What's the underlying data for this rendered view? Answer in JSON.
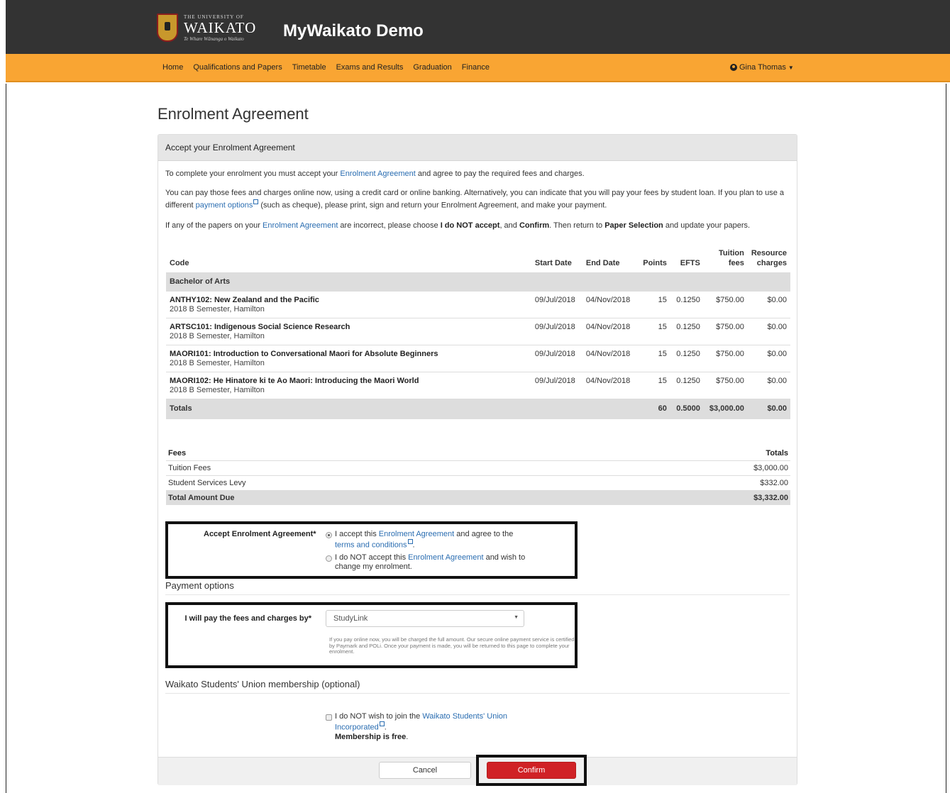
{
  "header": {
    "logo_small": "THE UNIVERSITY OF",
    "logo_big": "WAIKATO",
    "logo_sub": "Te Whare Wānanga o Waikato",
    "app_title": "MyWaikato Demo"
  },
  "nav": {
    "items": [
      "Home",
      "Qualifications and Papers",
      "Timetable",
      "Exams and Results",
      "Graduation",
      "Finance"
    ],
    "user": "Gina Thomas"
  },
  "page": {
    "title": "Enrolment Agreement"
  },
  "panel": {
    "heading": "Accept your Enrolment Agreement",
    "intro1_a": "To complete your enrolment you must accept your ",
    "intro1_link": "Enrolment Agreement",
    "intro1_b": " and agree to pay the required fees and charges.",
    "intro2_a": "You can pay those fees and charges online now, using a credit card or online banking. Alternatively, you can indicate that you will pay your fees by student loan. If you plan to use a different ",
    "intro2_link": "payment options",
    "intro2_b": " (such as cheque), please print, sign and return your Enrolment Agreement, and make your payment.",
    "intro3_a": "If any of the papers on your ",
    "intro3_link": "Enrolment Agreement",
    "intro3_b": " are incorrect, please choose ",
    "intro3_bold1": "I do NOT accept",
    "intro3_c": ", and ",
    "intro3_bold2": "Confirm",
    "intro3_d": ". Then return to ",
    "intro3_bold3": "Paper Selection",
    "intro3_e": " and update your papers."
  },
  "papers": {
    "headers": {
      "code": "Code",
      "start": "Start Date",
      "end": "End Date",
      "points": "Points",
      "efts": "EFTS",
      "tuition_1": "Tuition",
      "tuition_2": "fees",
      "resource_1": "Resource",
      "resource_2": "charges"
    },
    "group": "Bachelor of Arts",
    "rows": [
      {
        "name": "ANTHY102: New Zealand and the Pacific",
        "sub": "2018 B Semester, Hamilton",
        "start": "09/Jul/2018",
        "end": "04/Nov/2018",
        "points": "15",
        "efts": "0.1250",
        "tuition": "$750.00",
        "resource": "$0.00"
      },
      {
        "name": "ARTSC101: Indigenous Social Science Research",
        "sub": "2018 B Semester, Hamilton",
        "start": "09/Jul/2018",
        "end": "04/Nov/2018",
        "points": "15",
        "efts": "0.1250",
        "tuition": "$750.00",
        "resource": "$0.00"
      },
      {
        "name": "MAORI101: Introduction to Conversational Maori for Absolute Beginners",
        "sub": "2018 B Semester, Hamilton",
        "start": "09/Jul/2018",
        "end": "04/Nov/2018",
        "points": "15",
        "efts": "0.1250",
        "tuition": "$750.00",
        "resource": "$0.00"
      },
      {
        "name": "MAORI102: He Hinatore ki te Ao Maori: Introducing the Maori World",
        "sub": "2018 B Semester, Hamilton",
        "start": "09/Jul/2018",
        "end": "04/Nov/2018",
        "points": "15",
        "efts": "0.1250",
        "tuition": "$750.00",
        "resource": "$0.00"
      }
    ],
    "totals": {
      "label": "Totals",
      "points": "60",
      "efts": "0.5000",
      "tuition": "$3,000.00",
      "resource": "$0.00"
    }
  },
  "fees": {
    "header_label": "Fees",
    "header_total": "Totals",
    "rows": [
      {
        "label": "Tuition Fees",
        "value": "$3,000.00"
      },
      {
        "label": "Student Services Levy",
        "value": "$332.00"
      }
    ],
    "total": {
      "label": "Total Amount Due",
      "value": "$3,332.00"
    }
  },
  "accept": {
    "label": "Accept Enrolment Agreement*",
    "opt1_a": "I accept this ",
    "opt1_link": "Enrolment Agreement",
    "opt1_b": " and agree to the",
    "opt1_link2": "terms and conditions",
    "opt2_a": "I do NOT accept this ",
    "opt2_link": "Enrolment Agreement",
    "opt2_b": " and wish to change my enrolment."
  },
  "payment": {
    "section_title": "Payment options",
    "label": "I will pay the fees and charges by*",
    "selected": "StudyLink",
    "help": "If you pay online now, you will be charged the full amount. Our secure online payment service is certified by Paymark and POLi. Once your payment is made, you will be returned to this page to complete your enrolment."
  },
  "union": {
    "section_title": "Waikato Students' Union membership (optional)",
    "opt_a": "I do NOT wish to join the ",
    "opt_link": "Waikato Students' Union Incorporated",
    "opt_bold": "Membership is free"
  },
  "buttons": {
    "cancel": "Cancel",
    "confirm": "Confirm"
  },
  "colors": {
    "topbar": "#333333",
    "navbar": "#f9a533",
    "link": "#2a6db1",
    "confirm": "#d02226"
  }
}
